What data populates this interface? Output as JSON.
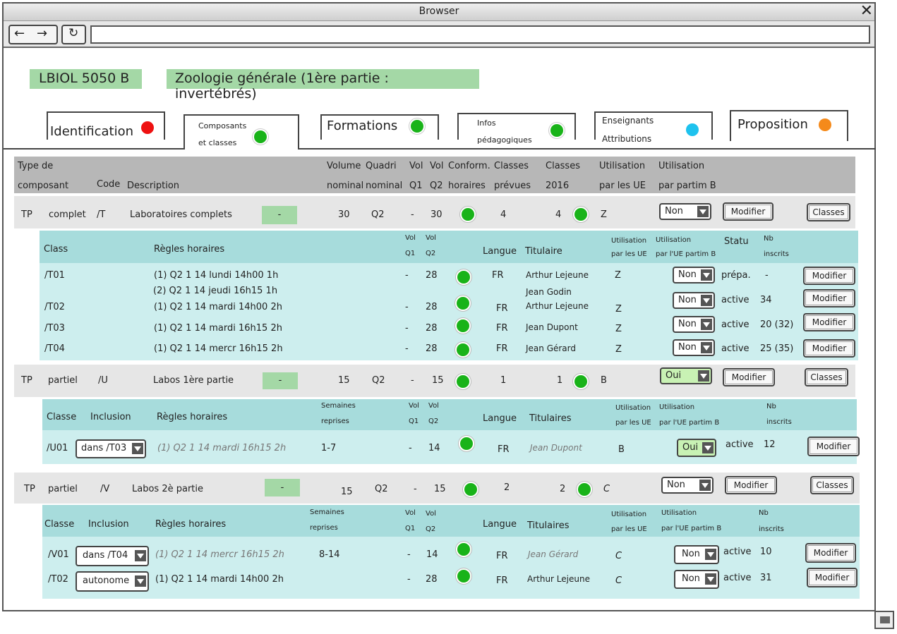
{
  "browser": {
    "title": "Browser",
    "url": ""
  },
  "course": {
    "code": "LBIOL 5050 B",
    "title": "Zoologie générale (1ère partie : invertébrés)"
  },
  "tabs": [
    {
      "label": "Identification",
      "status_color": "#e11111"
    },
    {
      "label_line1": "Composants",
      "label_line2": "et classes",
      "status_color": "#19b319"
    },
    {
      "label": "Formations",
      "status_color": "#19b319"
    },
    {
      "label_line1": "Infos",
      "label_line2": "pédagogiques",
      "status_color": "#19b319"
    },
    {
      "label_line1": "Enseignants",
      "label_line2": "Attributions",
      "status_color": "#1ec2ee"
    },
    {
      "label": "Proposition",
      "status_color": "#f58a1b"
    }
  ],
  "table_header": {
    "type_1": "Type de",
    "type_2": "composant",
    "code": "Code",
    "description": "Description",
    "volume_1": "Volume",
    "volume_2": "nominal",
    "quadri_1": "Quadri",
    "quadri_2": "nominal",
    "vol1_1": "Vol",
    "vol1_2": "Q1",
    "vol2_1": "Vol",
    "vol2_2": "Q2",
    "conform_1": "Conform.",
    "conform_2": "horaires",
    "classes_1": "Classes",
    "classes_2": "prévues",
    "classes2016_1": "Classes",
    "classes2016_2": "2016",
    "util_1": "Utilisation",
    "util_2": "par les UE",
    "utilb_1": "Utilisation",
    "utilb_2": "par partim B"
  },
  "components": [
    {
      "type": "TP",
      "subtype": "complet",
      "code": "/T",
      "description": "Laboratoires complets",
      "tag": "-",
      "volume": "30",
      "quadri": "Q2",
      "vol_q1": "-",
      "vol_q2": "30",
      "classes_prevues": "4",
      "classes_2016": "4",
      "util": "Z",
      "partim": "Non",
      "modify": "Modifier",
      "classes_btn": "Classes"
    },
    {
      "type": "TP",
      "subtype": "partiel",
      "code": "/U",
      "description": "Labos 1ère partie",
      "tag": "-",
      "volume": "15",
      "quadri": "Q2",
      "vol_q1": "-",
      "vol_q2": "15",
      "classes_prevues": "1",
      "classes_2016": "1",
      "util": "B",
      "partim": "Oui",
      "modify": "Modifier",
      "classes_btn": "Classes"
    },
    {
      "type": "TP",
      "subtype": "partiel",
      "code": "/V",
      "description": "Labos 2è partie",
      "tag": "-",
      "volume": "15",
      "quadri": "Q2",
      "vol_q1": "-",
      "vol_q2": "15",
      "classes_prevues": "2",
      "classes_2016": "2",
      "util": "C",
      "partim": "Non",
      "modify": "Modifier",
      "classes_btn": "Classes"
    }
  ],
  "sub1": {
    "header": {
      "class": "Class",
      "rules": "Règles horaires",
      "vq1_1": "Vol",
      "vq1_2": "Q1",
      "vq2_1": "Vol",
      "vq2_2": "Q2",
      "langue": "Langue",
      "titulaire": "Titulaire",
      "util_1": "Utilisation",
      "util_2": "par les UE",
      "utilb_1": "Utilisation",
      "utilb_2": "par l'UE partim B",
      "statu": "Statu",
      "nb_1": "Nb",
      "nb_2": "inscrits"
    },
    "rows": [
      {
        "class": "/T01",
        "rule": "(1)  Q2   1   14  lundi  14h00  1h",
        "rule2": "(2)  Q2   1   14  jeudi  16h15  1h",
        "vq1": "-",
        "vq2": "28",
        "langue": "FR",
        "titulaire": "Arthur Lejeune",
        "titulaire2": "Jean Godin",
        "util": "Z",
        "partim": "Non",
        "statu": "prépa.",
        "nb": "-",
        "modify": "Modifier"
      },
      {
        "class": "/T02",
        "rule": "(1)  Q2   1   14  mardi 14h00  2h",
        "vq1": "-",
        "vq2": "28",
        "langue": "FR",
        "titulaire": "Arthur Lejeune",
        "util": "Z",
        "partim": "Non",
        "statu": "active",
        "nb": "34",
        "modify": "Modifier"
      },
      {
        "class": "/T03",
        "rule": "(1)  Q2   1   14  mardi 16h15  2h",
        "vq1": "-",
        "vq2": "28",
        "langue": "FR",
        "titulaire": "Jean Dupont",
        "util": "Z",
        "partim": "Non",
        "statu": "active",
        "nb": "20 (32)",
        "modify": "Modifier"
      },
      {
        "class": "/T04",
        "rule": "(1)  Q2   1   14  mercr 16h15  2h",
        "vq1": "-",
        "vq2": "28",
        "langue": "FR",
        "titulaire": "Jean Gérard",
        "util": "Z",
        "partim": "Non",
        "statu": "active",
        "nb": "25 (35)",
        "modify": "Modifier"
      }
    ]
  },
  "sub2": {
    "header": {
      "classe": "Classe",
      "inclusion": "Inclusion",
      "rules": "Règles horaires",
      "sem_1": "Semaines",
      "sem_2": "reprises",
      "vq1_1": "Vol",
      "vq1_2": "Q1",
      "vq2_1": "Vol",
      "vq2_2": "Q2",
      "langue": "Langue",
      "titulaires": "Titulaires",
      "util_1": "Utilisation",
      "util_2": "par les UE",
      "utilb_1": "Utilisation",
      "utilb_2": "par l'UE partim B",
      "nb_1": "Nb",
      "nb_2": "inscrits"
    },
    "rows": [
      {
        "class": "/U01",
        "inclusion": "dans /T03",
        "rule": "(1)  Q2    1    14   mardi  16h15   2h",
        "sem": "1-7",
        "vq1": "-",
        "vq2": "14",
        "langue": "FR",
        "titulaire": "Jean Dupont",
        "util": "B",
        "partim": "Oui",
        "statu": "active",
        "nb": "12",
        "modify": "Modifier"
      }
    ]
  },
  "sub3": {
    "header": {
      "classe": "Classe",
      "inclusion": "Inclusion",
      "rules": "Règles horaires",
      "sem_1": "Semaines",
      "sem_2": "reprises",
      "vq1_1": "Vol",
      "vq1_2": "Q1",
      "vq2_1": "Vol",
      "vq2_2": "Q2",
      "langue": "Langue",
      "titulaires": "Titulaires",
      "util_1": "Utilisation",
      "util_2": "par les UE",
      "utilb_1": "Utilisation",
      "utilb_2": "par l'UE partim B",
      "nb_1": "Nb",
      "nb_2": "inscrits"
    },
    "rows": [
      {
        "class": "/V01",
        "inclusion": "dans /T04",
        "rule": "(1)  Q2    1    14   mercr 16h15   2h",
        "sem": "8-14",
        "vq1": "-",
        "vq2": "14",
        "langue": "FR",
        "titulaire": "Jean Gérard",
        "util": "C",
        "partim": "Non",
        "statu": "active",
        "nb": "10",
        "modify": "Modifier"
      },
      {
        "class": "/T02",
        "inclusion": "autonome",
        "rule": "(1)  Q2   1   14  mardi 14h00  2h",
        "sem": "",
        "vq1": "-",
        "vq2": "28",
        "langue": "FR",
        "titulaire": "Arthur Lejeune",
        "util": "C",
        "partim": "Non",
        "statu": "active",
        "nb": "31",
        "modify": "Modifier"
      }
    ]
  }
}
